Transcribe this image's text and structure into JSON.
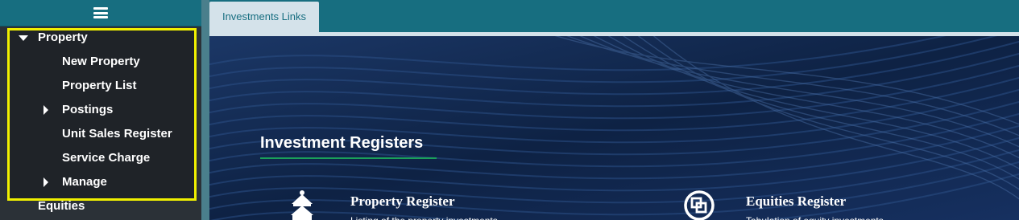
{
  "sidebar": {
    "menu_icon": "hamburger-menu-icon",
    "items": [
      {
        "label": "Property",
        "icon": "caret-down-icon"
      },
      {
        "label": "New Property"
      },
      {
        "label": "Property List"
      },
      {
        "label": "Postings",
        "icon": "caret-right-icon"
      },
      {
        "label": "Unit Sales Register"
      },
      {
        "label": "Service Charge"
      },
      {
        "label": "Manage",
        "icon": "caret-right-icon"
      },
      {
        "label": "Equities"
      }
    ],
    "highlight_color": "#f0f000"
  },
  "tabs": [
    {
      "label": "Investments Links"
    }
  ],
  "content": {
    "section_title": "Investment Registers",
    "cards": [
      {
        "title": "Property Register",
        "desc": "Listing of the property investments",
        "icon": "building-icon"
      },
      {
        "title": "Equities Register",
        "desc": "Tabulation of equity investments",
        "icon": "equities-icon"
      }
    ]
  },
  "colors": {
    "accent": "#176e80",
    "sidebar_bg": "#2b3137",
    "hero_bg": "#132b52",
    "title_underline": "#1aa05a"
  }
}
